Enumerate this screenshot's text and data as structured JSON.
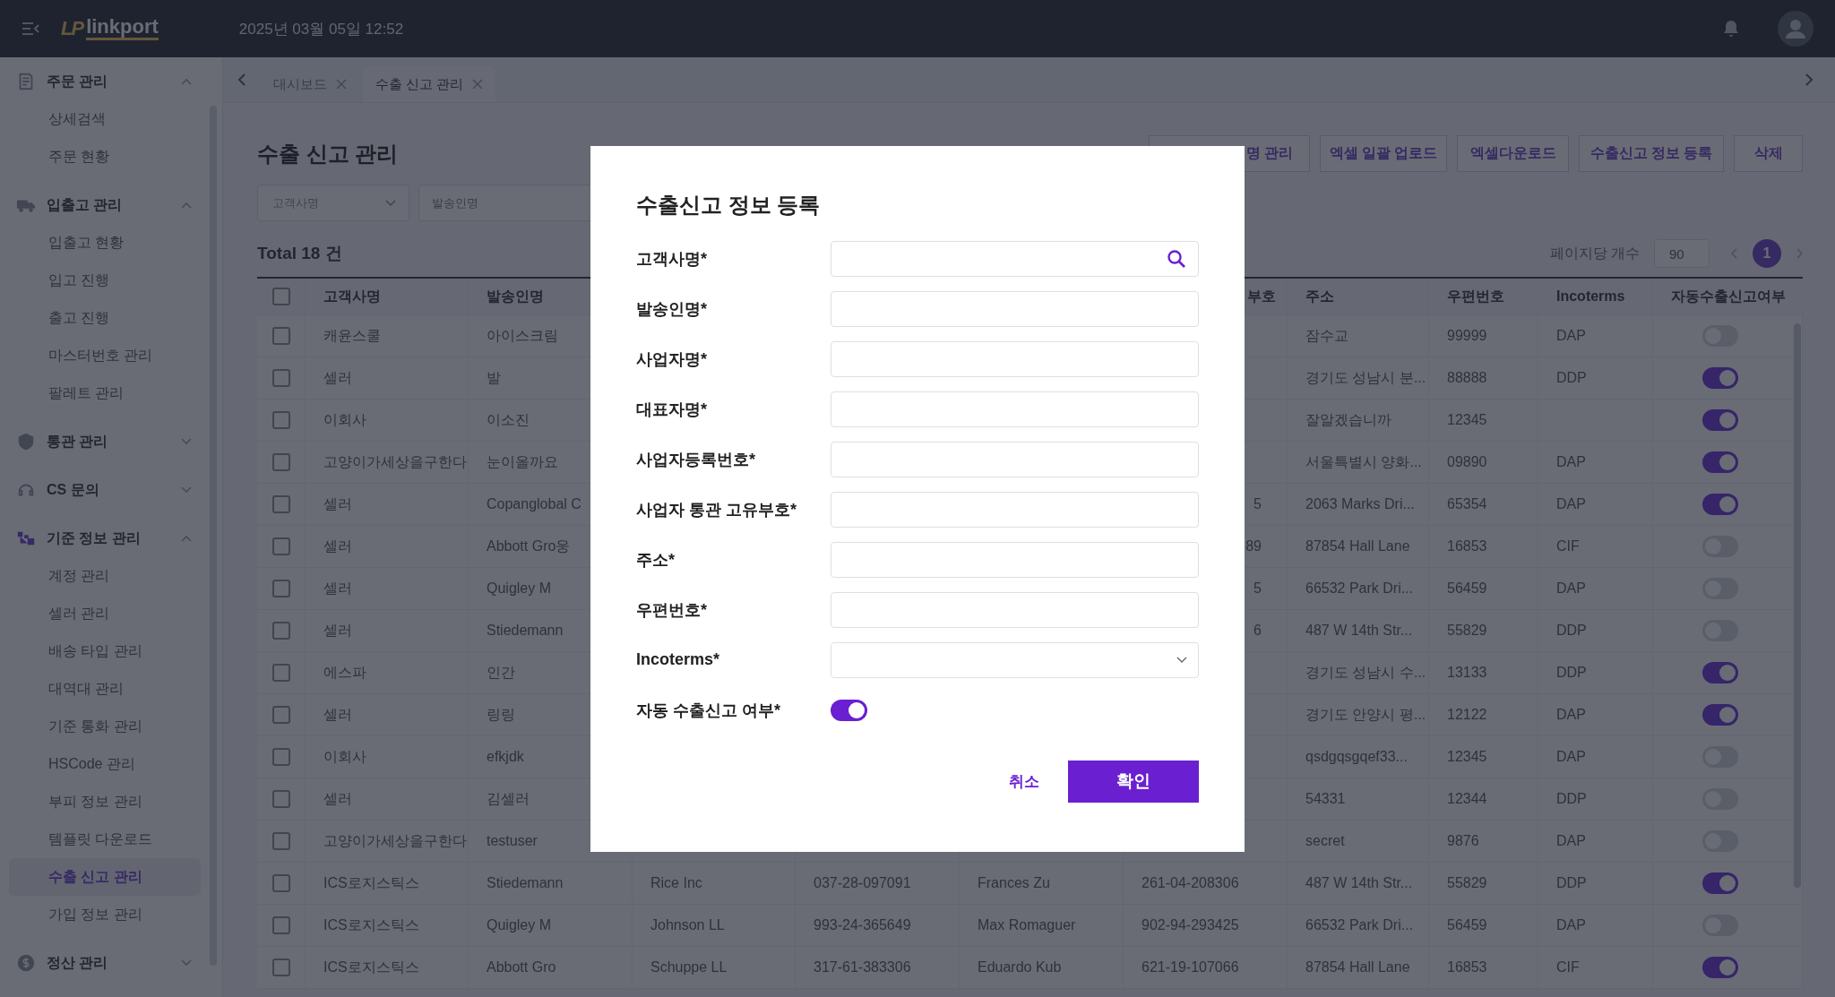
{
  "topbar": {
    "logo_mark": "LP",
    "logo_name": "linkport",
    "datetime": "2025년 03월 05일 12:52"
  },
  "sidebar": {
    "sections": [
      {
        "label": "주문 관리",
        "expanded": true,
        "active": false,
        "children": [
          {
            "label": "상세검색",
            "selected": false
          },
          {
            "label": "주문 현황",
            "selected": false
          }
        ]
      },
      {
        "label": "입출고 관리",
        "expanded": true,
        "active": false,
        "children": [
          {
            "label": "입출고 현황",
            "selected": false
          },
          {
            "label": "입고 진행",
            "selected": false
          },
          {
            "label": "출고 진행",
            "selected": false
          },
          {
            "label": "마스터번호 관리",
            "selected": false
          },
          {
            "label": "팔레트 관리",
            "selected": false
          }
        ]
      },
      {
        "label": "통관 관리",
        "expanded": false,
        "active": false
      },
      {
        "label": "CS 문의",
        "expanded": false,
        "active": false
      },
      {
        "label": "기준 정보 관리",
        "expanded": true,
        "active": true,
        "children": [
          {
            "label": "계정 관리",
            "selected": false
          },
          {
            "label": "셀러 관리",
            "selected": false
          },
          {
            "label": "배송 타입 관리",
            "selected": false
          },
          {
            "label": "대역대 관리",
            "selected": false
          },
          {
            "label": "기준 통화 관리",
            "selected": false
          },
          {
            "label": "HSCode 관리",
            "selected": false
          },
          {
            "label": "부피 정보 관리",
            "selected": false
          },
          {
            "label": "템플릿 다운로드",
            "selected": false
          },
          {
            "label": "수출 신고 관리",
            "selected": true
          },
          {
            "label": "가입 정보 관리",
            "selected": false
          }
        ]
      },
      {
        "label": "정산 관리",
        "expanded": false,
        "active": false
      }
    ]
  },
  "tabs": [
    {
      "label": "대시보드",
      "selected": false
    },
    {
      "label": "수출 신고 관리",
      "selected": true
    }
  ],
  "page": {
    "title": "수출 신고 관리",
    "buttons": [
      {
        "label": "명 관리",
        "cut": true
      },
      {
        "label": "엑셀 일괄 업로드",
        "cut": false
      },
      {
        "label": "엑셀다운로드",
        "cut": false
      },
      {
        "label": "수출신고 정보 등록",
        "cut": false
      },
      {
        "label": "삭제",
        "cut": false
      }
    ],
    "filters": [
      {
        "kind": "select",
        "placeholder": "고객사명"
      },
      {
        "kind": "text",
        "placeholder": "발송인명"
      }
    ],
    "total": "Total 18 건",
    "page_size_label": "페이지당 개수",
    "page_size": "90",
    "pages": [
      {
        "label": "1",
        "selected": true
      }
    ]
  },
  "table": {
    "all_checked": false,
    "headers": {
      "customer": "고객사명",
      "sender": "발송인명",
      "customs_code_tail": "부호",
      "address": "주소",
      "zip": "우편번호",
      "incoterms": "Incoterms",
      "auto": "자동수출신고여부"
    },
    "rows": [
      {
        "checked": false,
        "customer": "캐윤스쿨",
        "sender": "아이스크림",
        "address": "잠수교",
        "zip": "99999",
        "incoterms": "DAP",
        "auto": false
      },
      {
        "checked": false,
        "customer": "셀러",
        "sender": "발",
        "address": "경기도 성남시 분...",
        "zip": "88888",
        "incoterms": "DDP",
        "auto": true
      },
      {
        "checked": false,
        "customer": "이회사",
        "sender": "이소진",
        "address": "잘알겠습니까",
        "zip": "12345",
        "auto": true
      },
      {
        "checked": false,
        "customer": "고양이가세상을구한다",
        "sender": "눈이올까요",
        "address": "서울특별시 양화...",
        "zip": "09890",
        "incoterms": "DAP",
        "auto": true
      },
      {
        "checked": false,
        "customer": "셀러",
        "sender": "Copanglobal C",
        "customs_code_tail": "5",
        "address": "2063 Marks Dri...",
        "zip": "65354",
        "incoterms": "DAP",
        "auto": true
      },
      {
        "checked": false,
        "customer": "셀러",
        "sender": "Abbott Gro웅",
        "customs_code_tail": "89",
        "address": "87854 Hall Lane",
        "zip": "16853",
        "incoterms": "CIF",
        "auto": false
      },
      {
        "checked": false,
        "customer": "셀러",
        "sender": "Quigley M",
        "customs_code_tail": "5",
        "address": "66532 Park Dri...",
        "zip": "56459",
        "incoterms": "DAP",
        "auto": false
      },
      {
        "checked": false,
        "customer": "셀러",
        "sender": "Stiedemann",
        "customs_code_tail": "6",
        "address": "487 W 14th Str...",
        "zip": "55829",
        "incoterms": "DDP",
        "auto": false
      },
      {
        "checked": false,
        "customer": "에스파",
        "sender": "인간",
        "address": "경기도 성남시 수...",
        "zip": "13133",
        "incoterms": "DDP",
        "auto": true
      },
      {
        "checked": false,
        "customer": "셀러",
        "sender": "링링",
        "address": "경기도 안양시 평...",
        "zip": "12122",
        "incoterms": "DAP",
        "auto": true
      },
      {
        "checked": false,
        "customer": "이회사",
        "sender": "efkjdk",
        "address": "qsdgqsgqef33...",
        "zip": "12345",
        "incoterms": "DAP",
        "auto": false
      },
      {
        "checked": false,
        "customer": "셀러",
        "sender": "김셀러",
        "address": "54331",
        "zip": "12344",
        "incoterms": "DDP",
        "auto": false
      },
      {
        "checked": false,
        "customer": "고양이가세상을구한다",
        "sender": "testuser",
        "address": "secret",
        "zip": "9876",
        "incoterms": "DAP",
        "auto": false
      },
      {
        "checked": false,
        "customer": "ICS로지스틱스",
        "sender": "Stiedemann",
        "company": "Rice Inc",
        "business_no": "037-28-097091",
        "representative": "Frances Zu",
        "customs_code": "261-04-208306",
        "address": "487 W 14th Str...",
        "zip": "55829",
        "incoterms": "DDP",
        "auto": true
      },
      {
        "checked": false,
        "customer": "ICS로지스틱스",
        "sender": "Quigley M",
        "company": "Johnson LL",
        "business_no": "993-24-365649",
        "representative": "Max Romaguer",
        "customs_code": "902-94-293425",
        "address": "66532 Park Dri...",
        "zip": "56459",
        "incoterms": "DAP",
        "auto": false
      },
      {
        "checked": false,
        "customer": "ICS로지스틱스",
        "sender": "Abbott Gro",
        "company": "Schuppe LL",
        "business_no": "317-61-383306",
        "representative": "Eduardo Kub",
        "customs_code": "621-19-107066",
        "address": "87854 Hall Lane",
        "zip": "16853",
        "incoterms": "CIF",
        "auto": true
      }
    ]
  },
  "dialog": {
    "title": "수출신고 정보 등록",
    "fields": [
      {
        "kind": "search",
        "label": "고객사명*"
      },
      {
        "kind": "text",
        "label": "발송인명*"
      },
      {
        "kind": "text",
        "label": "사업자명*"
      },
      {
        "kind": "text",
        "label": "대표자명*"
      },
      {
        "kind": "text",
        "label": "사업자등록번호*"
      },
      {
        "kind": "text",
        "label": "사업자 통관 고유부호*"
      },
      {
        "kind": "text",
        "label": "주소*"
      },
      {
        "kind": "text",
        "label": "우편번호*"
      },
      {
        "kind": "select",
        "label": "Incoterms*"
      },
      {
        "kind": "toggle",
        "label": "자동 수출신고 여부*",
        "on": true
      }
    ],
    "cancel": "취소",
    "confirm": "확인"
  }
}
